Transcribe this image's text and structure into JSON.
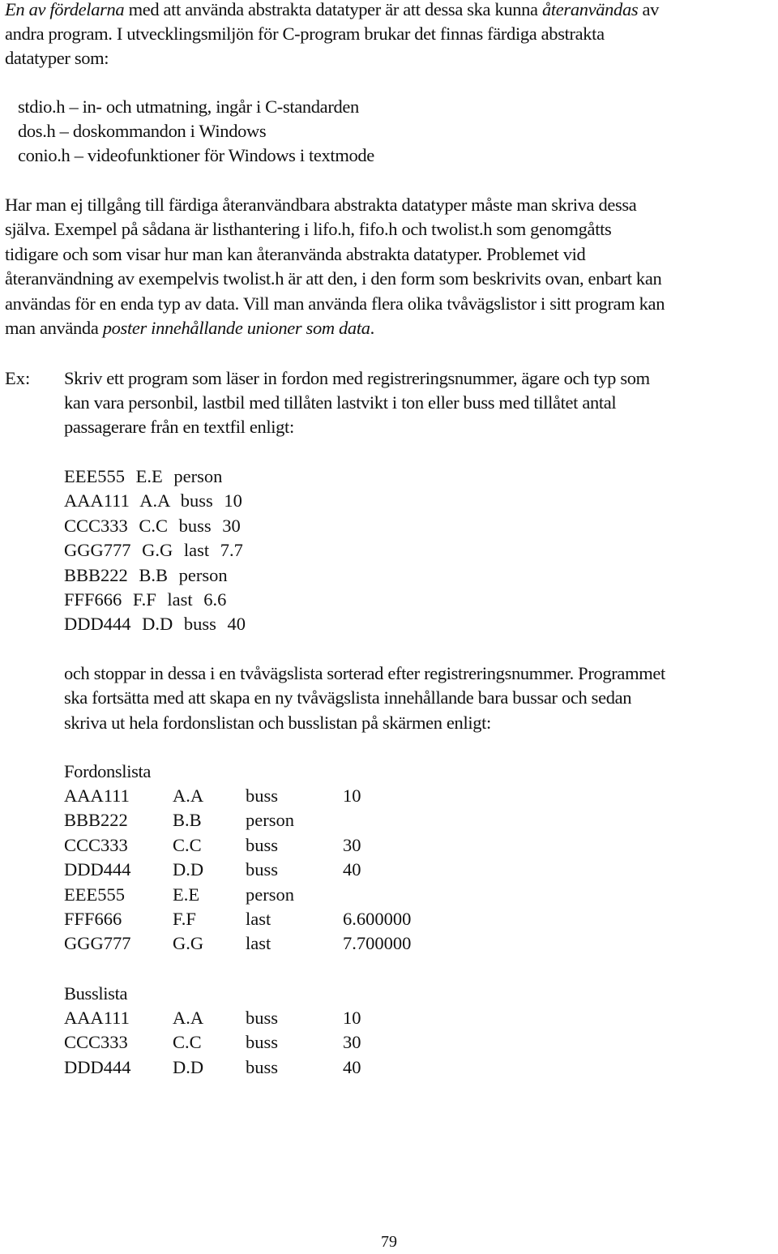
{
  "intro": {
    "line1_italic_start": "En av fördelarna",
    "line1_mid": " med att använda abstrakta datatyper är att dessa ska kunna ",
    "line1_italic_end": "återanvändas",
    "line1_tail": " av",
    "line2": "andra program. I utvecklingsmiljön för C-program brukar det finnas färdiga abstrakta",
    "line3": "datatyper som:"
  },
  "headers_list": [
    "stdio.h – in- och utmatning, ingår i C-standarden",
    "dos.h – doskommandon i Windows",
    "conio.h – videofunktioner för Windows i textmode"
  ],
  "paragraph2": {
    "lines": [
      "Har man ej tillgång till färdiga återanvändbara abstrakta datatyper måste man skriva dessa",
      "själva. Exempel på sådana är listhantering i lifo.h, fifo.h och twolist.h som genomgåtts",
      "tidigare och som visar hur man kan återanvända abstrakta datatyper. Problemet vid",
      "återanvändning av exempelvis twolist.h är att den, i den form som beskrivits ovan, enbart kan",
      "användas för en enda typ av data. Vill man använda flera olika tvåvägslistor i sitt program kan"
    ],
    "last_line_start": "man använda ",
    "last_line_italic": "poster innehållande unioner som data",
    "last_line_end": "."
  },
  "example": {
    "label": "Ex:",
    "lines": [
      "Skriv ett program som läser in fordon med registreringsnummer, ägare och typ som",
      "kan vara personbil, lastbil med tillåten lastvikt i ton eller buss med tillåtet antal",
      "passagerare från en textfil enligt:"
    ],
    "input_file": [
      "EEE555 E.E person",
      "AAA111 A.A buss 10",
      "CCC333 C.C buss 30",
      "GGG777 G.G last 7.7",
      "BBB222 B.B person",
      "FFF666 F.F last 6.6",
      "DDD444 D.D buss 40"
    ],
    "continuation": [
      "och stoppar in dessa i en tvåvägslista sorterad efter registreringsnummer. Programmet",
      "ska fortsätta med att skapa en ny tvåvägslista innehållande bara bussar och sedan",
      "skriva ut hela fordonslistan och busslistan på skärmen enligt:"
    ],
    "fordonslista": {
      "title": "Fordonslista",
      "rows": [
        [
          "AAA111",
          "A.A",
          "buss",
          "10"
        ],
        [
          "BBB222",
          "B.B",
          "person",
          ""
        ],
        [
          "CCC333",
          "C.C",
          "buss",
          "30"
        ],
        [
          "DDD444",
          "D.D",
          "buss",
          "40"
        ],
        [
          "EEE555",
          "E.E",
          "person",
          ""
        ],
        [
          "FFF666",
          "F.F",
          "last",
          "6.600000"
        ],
        [
          "GGG777",
          "G.G",
          "last",
          "7.700000"
        ]
      ]
    },
    "busslista": {
      "title": "Busslista",
      "rows": [
        [
          "AAA111",
          "A.A",
          "buss",
          "10"
        ],
        [
          "CCC333",
          "C.C",
          "buss",
          "30"
        ],
        [
          "DDD444",
          "D.D",
          "buss",
          "40"
        ]
      ]
    }
  },
  "page_number": "79"
}
